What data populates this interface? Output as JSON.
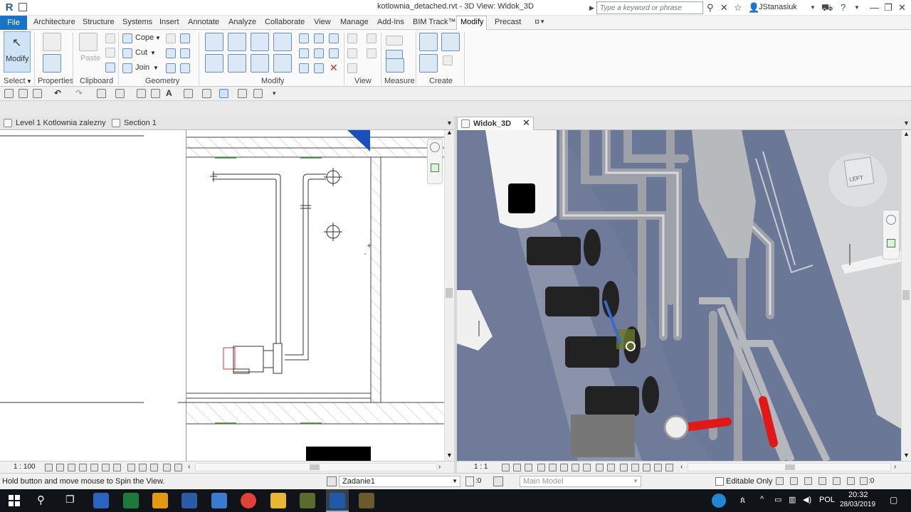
{
  "title": "kotlownia_detached.rvt - 3D View: Widok_3D",
  "search": {
    "placeholder": "Type a keyword or phrase"
  },
  "user": {
    "name": "JStanasiuk"
  },
  "tabs": [
    "File",
    "Architecture",
    "Structure",
    "Systems",
    "Insert",
    "Annotate",
    "Analyze",
    "Collaborate",
    "View",
    "Manage",
    "Add-Ins",
    "BIM Track™",
    "Modify",
    "Precast"
  ],
  "active_tab": "Modify",
  "ribbon": {
    "modify_label": "Modify",
    "paste_label": "Paste",
    "cope_label": "Cope",
    "cut_label": "Cut",
    "join_label": "Join",
    "panels": [
      "Select",
      "Properties",
      "Clipboard",
      "Geometry",
      "Modify",
      "View",
      "Measure",
      "Create"
    ]
  },
  "views": {
    "left_tabs": [
      "Level 1 Kotlownia zalezny",
      "Section 1"
    ],
    "right_tab": "Widok_3D",
    "left_scale": "1 : 100",
    "right_scale": "1 : 1",
    "viewcube_label": "LEFT"
  },
  "status": {
    "message": "Hold button and move mouse to Spin the View.",
    "workset": "Zadanie1",
    "workset_count": ":0",
    "design_option": "Main Model",
    "editable_only": "Editable Only",
    "filter_count": ":0"
  },
  "taskbar": {
    "language": "POL",
    "time": "20:32",
    "date": "28/03/2019"
  },
  "colors": {
    "accent": "#1a73c7",
    "viewport_3d_background": "#6b7796",
    "pipe_red": "#e01818"
  }
}
